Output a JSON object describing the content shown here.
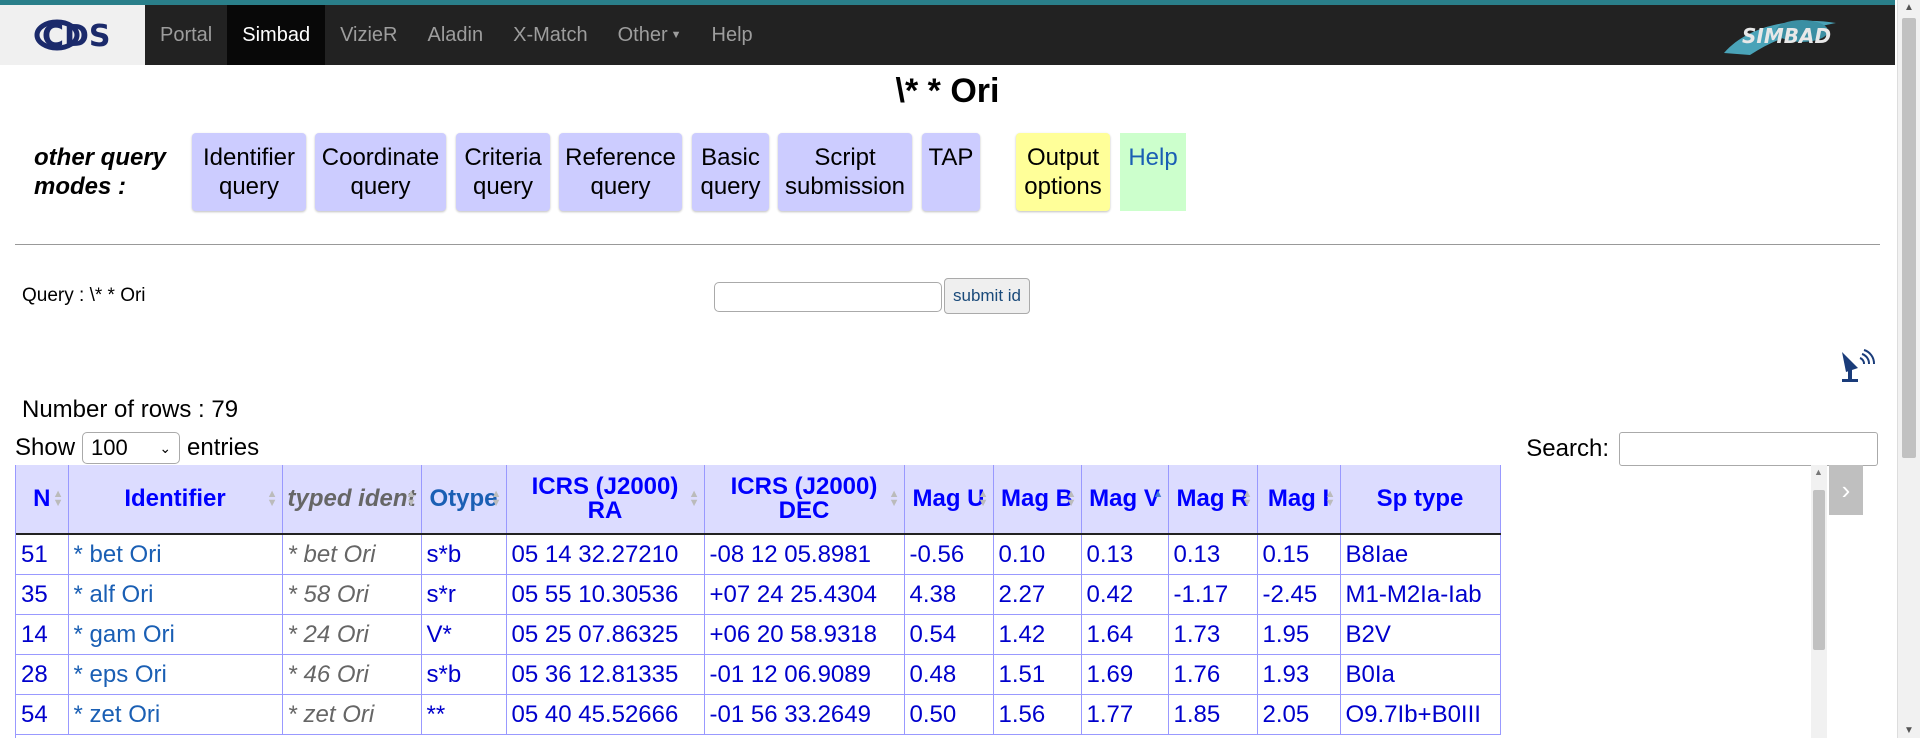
{
  "nav": {
    "logo": "CDS",
    "items": [
      "Portal",
      "Simbad",
      "VizieR",
      "Aladin",
      "X-Match",
      "Other",
      "Help"
    ],
    "simbad_logo": "SIMBAD"
  },
  "page": {
    "title": "\\* * Ori"
  },
  "modes": {
    "label": "other query modes :",
    "buttons": [
      {
        "line1": "Identifier",
        "line2": "query"
      },
      {
        "line1": "Coordinate",
        "line2": "query"
      },
      {
        "line1": "Criteria",
        "line2": "query"
      },
      {
        "line1": "Reference",
        "line2": "query"
      },
      {
        "line1": "Basic",
        "line2": "query"
      },
      {
        "line1": "Script",
        "line2": "submission"
      },
      {
        "line1": "TAP",
        "line2": ""
      },
      {
        "line1": "Output",
        "line2": "options"
      },
      {
        "line1": "Help",
        "line2": ""
      }
    ]
  },
  "query": {
    "label": "Query : \\* * Ori",
    "input_value": "",
    "submit_label": "submit id"
  },
  "results": {
    "rows_label": "Number of rows : 79",
    "show_label": "Show",
    "entries_value": "100",
    "entries_label": "entries",
    "search_label": "Search:",
    "search_value": ""
  },
  "table": {
    "columns": [
      "N",
      "Identifier",
      "typed ident",
      "Otype",
      "ICRS (J2000)",
      "RA",
      "ICRS (J2000)",
      "DEC",
      "Mag U",
      "Mag B",
      "Mag V",
      "Mag R",
      "Mag I",
      "Sp type"
    ],
    "rows": [
      [
        "51",
        "* bet Ori",
        "* bet Ori",
        "s*b",
        "05 14 32.27210",
        "-08 12 05.8981",
        "-0.56",
        "0.10",
        "0.13",
        "0.13",
        "0.15",
        "B8Iae"
      ],
      [
        "35",
        "* alf Ori",
        "* 58 Ori",
        "s*r",
        "05 55 10.30536",
        "+07 24 25.4304",
        "4.38",
        "2.27",
        "0.42",
        "-1.17",
        "-2.45",
        "M1-M2Ia-Iab"
      ],
      [
        "14",
        "* gam Ori",
        "* 24 Ori",
        "V*",
        "05 25 07.86325",
        "+06 20 58.9318",
        "0.54",
        "1.42",
        "1.64",
        "1.73",
        "1.95",
        "B2V"
      ],
      [
        "28",
        "* eps Ori",
        "* 46 Ori",
        "s*b",
        "05 36 12.81335",
        "-01 12 06.9089",
        "0.48",
        "1.51",
        "1.69",
        "1.76",
        "1.93",
        "B0Ia"
      ],
      [
        "54",
        "* zet Ori",
        "* zet Ori",
        "**",
        "05 40 45.52666",
        "-01 56 33.2649",
        "0.50",
        "1.56",
        "1.77",
        "1.85",
        "2.05",
        "O9.7Ib+B0III"
      ]
    ]
  }
}
